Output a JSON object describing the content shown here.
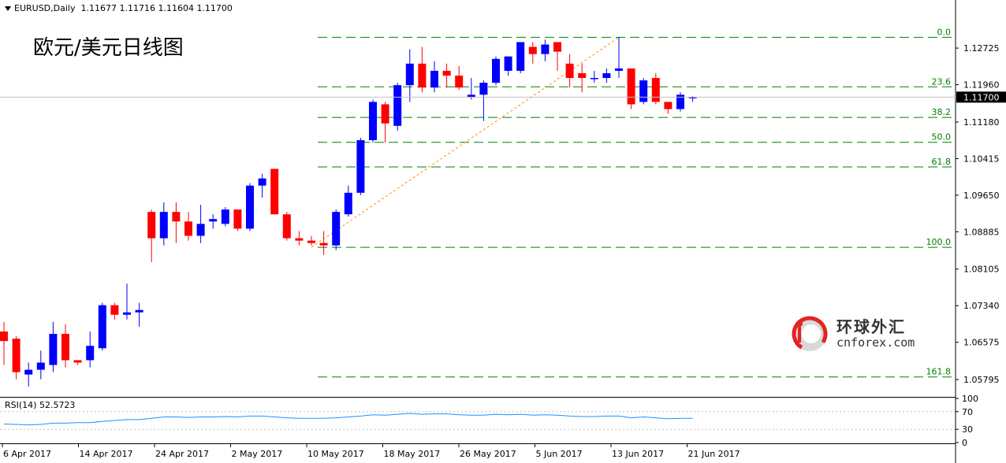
{
  "header": {
    "symbol": "EURUSD,Daily",
    "ohlc": "1.11677 1.11716 1.11604 1.11700"
  },
  "chart_title": "欧元/美元日线图",
  "logo": {
    "text_cn": "环球外汇",
    "text_en": "cnforex.com"
  },
  "colors": {
    "bull": "#0000ff",
    "bear": "#ff0000",
    "fib_line": "#008000",
    "trend_line": "#ff8c00",
    "rsi_line": "#1e90ff",
    "current_price_bg": "#000000",
    "price_line": "#c0c0c0"
  },
  "chart_data": {
    "type": "candlestick",
    "symbol": "EURUSD",
    "timeframe": "Daily",
    "ylim": [
      1.0545,
      1.135
    ],
    "y_ticks": [
      "1.12725",
      "1.11960",
      "1.11180",
      "1.10415",
      "1.09650",
      "1.08885",
      "1.08105",
      "1.07340",
      "1.06575",
      "1.05795"
    ],
    "x_ticks": [
      "6 Apr 2017",
      "14 Apr 2017",
      "24 Apr 2017",
      "2 May 2017",
      "10 May 2017",
      "18 May 2017",
      "26 May 2017",
      "5 Jun 2017",
      "13 Jun 2017",
      "21 Jun 2017"
    ],
    "current_price": "1.11700",
    "candles": [
      {
        "o": 1.068,
        "h": 1.07,
        "l": 1.061,
        "c": 1.066
      },
      {
        "o": 1.0665,
        "h": 1.067,
        "l": 1.058,
        "c": 1.0595
      },
      {
        "o": 1.059,
        "h": 1.0615,
        "l": 1.0565,
        "c": 1.06
      },
      {
        "o": 1.06,
        "h": 1.064,
        "l": 1.058,
        "c": 1.0615
      },
      {
        "o": 1.061,
        "h": 1.07,
        "l": 1.0595,
        "c": 1.0675
      },
      {
        "o": 1.0675,
        "h": 1.0695,
        "l": 1.0605,
        "c": 1.062
      },
      {
        "o": 1.062,
        "h": 1.062,
        "l": 1.061,
        "c": 1.0615
      },
      {
        "o": 1.062,
        "h": 1.068,
        "l": 1.0605,
        "c": 1.065
      },
      {
        "o": 1.0645,
        "h": 1.074,
        "l": 1.064,
        "c": 1.0735
      },
      {
        "o": 1.0735,
        "h": 1.074,
        "l": 1.0705,
        "c": 1.0715
      },
      {
        "o": 1.0715,
        "h": 1.078,
        "l": 1.0705,
        "c": 1.072
      },
      {
        "o": 1.072,
        "h": 1.074,
        "l": 1.069,
        "c": 1.0725
      },
      {
        "o": 1.093,
        "h": 1.0935,
        "l": 1.0825,
        "c": 1.0875
      },
      {
        "o": 1.0875,
        "h": 1.095,
        "l": 1.086,
        "c": 1.093
      },
      {
        "o": 1.093,
        "h": 1.095,
        "l": 1.0865,
        "c": 1.091
      },
      {
        "o": 1.091,
        "h": 1.093,
        "l": 1.087,
        "c": 1.088
      },
      {
        "o": 1.088,
        "h": 1.0945,
        "l": 1.0865,
        "c": 1.0905
      },
      {
        "o": 1.091,
        "h": 1.0925,
        "l": 1.0895,
        "c": 1.0915
      },
      {
        "o": 1.0905,
        "h": 1.094,
        "l": 1.09,
        "c": 1.0935
      },
      {
        "o": 1.0935,
        "h": 1.0935,
        "l": 1.089,
        "c": 1.0895
      },
      {
        "o": 1.0895,
        "h": 1.099,
        "l": 1.089,
        "c": 1.0985
      },
      {
        "o": 1.0985,
        "h": 1.101,
        "l": 1.096,
        "c": 1.1
      },
      {
        "o": 1.102,
        "h": 1.102,
        "l": 1.093,
        "c": 1.0925
      },
      {
        "o": 1.0925,
        "h": 1.093,
        "l": 1.087,
        "c": 1.0875
      },
      {
        "o": 1.0875,
        "h": 1.089,
        "l": 1.086,
        "c": 1.087
      },
      {
        "o": 1.087,
        "h": 1.088,
        "l": 1.086,
        "c": 1.0865
      },
      {
        "o": 1.0865,
        "h": 1.089,
        "l": 1.084,
        "c": 1.086
      },
      {
        "o": 1.086,
        "h": 1.0935,
        "l": 1.085,
        "c": 1.093
      },
      {
        "o": 1.0925,
        "h": 1.0985,
        "l": 1.092,
        "c": 1.097
      },
      {
        "o": 1.097,
        "h": 1.1085,
        "l": 1.0965,
        "c": 1.108
      },
      {
        "o": 1.108,
        "h": 1.1165,
        "l": 1.1075,
        "c": 1.116
      },
      {
        "o": 1.1155,
        "h": 1.116,
        "l": 1.1075,
        "c": 1.1115
      },
      {
        "o": 1.111,
        "h": 1.12,
        "l": 1.11,
        "c": 1.1195
      },
      {
        "o": 1.1195,
        "h": 1.127,
        "l": 1.116,
        "c": 1.124
      },
      {
        "o": 1.124,
        "h": 1.1275,
        "l": 1.118,
        "c": 1.119
      },
      {
        "o": 1.119,
        "h": 1.1245,
        "l": 1.118,
        "c": 1.1225
      },
      {
        "o": 1.1225,
        "h": 1.124,
        "l": 1.119,
        "c": 1.1215
      },
      {
        "o": 1.1215,
        "h": 1.1235,
        "l": 1.1185,
        "c": 1.119
      },
      {
        "o": 1.117,
        "h": 1.121,
        "l": 1.1165,
        "c": 1.1175
      },
      {
        "o": 1.1175,
        "h": 1.1205,
        "l": 1.112,
        "c": 1.12
      },
      {
        "o": 1.12,
        "h": 1.1255,
        "l": 1.1195,
        "c": 1.125
      },
      {
        "o": 1.1225,
        "h": 1.1255,
        "l": 1.1215,
        "c": 1.1255
      },
      {
        "o": 1.1225,
        "h": 1.1285,
        "l": 1.122,
        "c": 1.1285
      },
      {
        "o": 1.1275,
        "h": 1.1285,
        "l": 1.124,
        "c": 1.126
      },
      {
        "o": 1.126,
        "h": 1.129,
        "l": 1.1245,
        "c": 1.128
      },
      {
        "o": 1.1285,
        "h": 1.1285,
        "l": 1.1225,
        "c": 1.1265
      },
      {
        "o": 1.124,
        "h": 1.126,
        "l": 1.119,
        "c": 1.121
      },
      {
        "o": 1.122,
        "h": 1.124,
        "l": 1.118,
        "c": 1.121
      },
      {
        "o": 1.121,
        "h": 1.1225,
        "l": 1.12,
        "c": 1.121
      },
      {
        "o": 1.121,
        "h": 1.123,
        "l": 1.12,
        "c": 1.122
      },
      {
        "o": 1.1225,
        "h": 1.1295,
        "l": 1.121,
        "c": 1.123
      },
      {
        "o": 1.123,
        "h": 1.123,
        "l": 1.1145,
        "c": 1.1155
      },
      {
        "o": 1.116,
        "h": 1.121,
        "l": 1.1155,
        "c": 1.1205
      },
      {
        "o": 1.121,
        "h": 1.122,
        "l": 1.1155,
        "c": 1.116
      },
      {
        "o": 1.116,
        "h": 1.116,
        "l": 1.1135,
        "c": 1.1145
      },
      {
        "o": 1.1145,
        "h": 1.118,
        "l": 1.114,
        "c": 1.1175
      },
      {
        "o": 1.1168,
        "h": 1.1172,
        "l": 1.116,
        "c": 1.117
      }
    ],
    "fibonacci": {
      "levels": [
        {
          "label": "0.0",
          "value": 1.1295
        },
        {
          "label": "23.6",
          "value": 1.11915
        },
        {
          "label": "38.2",
          "value": 1.11275
        },
        {
          "label": "50.0",
          "value": 1.10755
        },
        {
          "label": "61.8",
          "value": 1.1024
        },
        {
          "label": "100.0",
          "value": 1.0856
        },
        {
          "label": "161.8",
          "value": 1.0585
        }
      ]
    },
    "trend_line": {
      "from_candle": 25,
      "from_value": 1.0856,
      "to_candle": 50,
      "to_value": 1.1295
    },
    "rsi": {
      "period": 14,
      "label": "RSI(14) 52.5723",
      "ylim": [
        0,
        100
      ],
      "y_ticks": [
        "100",
        "70",
        "30",
        "0"
      ],
      "values": [
        42,
        41,
        40,
        41,
        44,
        44,
        45,
        45,
        48,
        50,
        52,
        52,
        55,
        58,
        58,
        57,
        58,
        58,
        59,
        58,
        60,
        60,
        58,
        56,
        55,
        55,
        55,
        56,
        58,
        60,
        63,
        62,
        64,
        66,
        64,
        65,
        65,
        63,
        62,
        62,
        64,
        63,
        64,
        62,
        63,
        62,
        60,
        59,
        59,
        60,
        60,
        56,
        58,
        56,
        54,
        55,
        55
      ]
    }
  }
}
